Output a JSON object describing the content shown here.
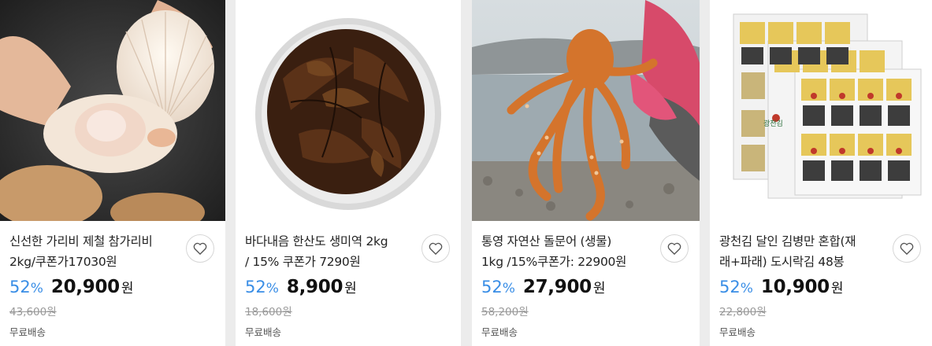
{
  "products": [
    {
      "title_line1": "신선한 가리비 제철 참가리비",
      "title_line2": "2kg/쿠폰가17030원",
      "image": "scallop-photo",
      "discount_rate": "52",
      "discount_unit": "%",
      "price": "20,900",
      "currency": "원",
      "original_price": "43,600원",
      "shipping": "무료배송",
      "wishlist_icon": "heart-icon"
    },
    {
      "title_line1": "바다내음 한산도 생미역 2kg",
      "title_line2": "/ 15% 쿠폰가 7290원",
      "image": "seaweed-photo",
      "discount_rate": "52",
      "discount_unit": "%",
      "price": "8,900",
      "currency": "원",
      "original_price": "18,600원",
      "shipping": "무료배송",
      "wishlist_icon": "heart-icon"
    },
    {
      "title_line1": "통영 자연산 돌문어 (생물)",
      "title_line2": "1kg /15%쿠폰가: 22900원",
      "image": "octopus-photo",
      "discount_rate": "52",
      "discount_unit": "%",
      "price": "27,900",
      "currency": "원",
      "original_price": "58,200원",
      "shipping": "무료배송",
      "wishlist_icon": "heart-icon"
    },
    {
      "title_line1": "광천김 달인 김병만 혼합(재",
      "title_line2": "래+파래) 도시락김 48봉",
      "image": "seaweed-snack-package-photo",
      "package_label": "광천김",
      "discount_rate": "52",
      "discount_unit": "%",
      "price": "10,900",
      "currency": "원",
      "original_price": "22,800원",
      "shipping": "무료배송",
      "wishlist_icon": "heart-icon"
    }
  ],
  "colors": {
    "discount": "#3a8ee6",
    "price": "#111111",
    "strikethrough": "#999999",
    "background": "#ececec"
  }
}
